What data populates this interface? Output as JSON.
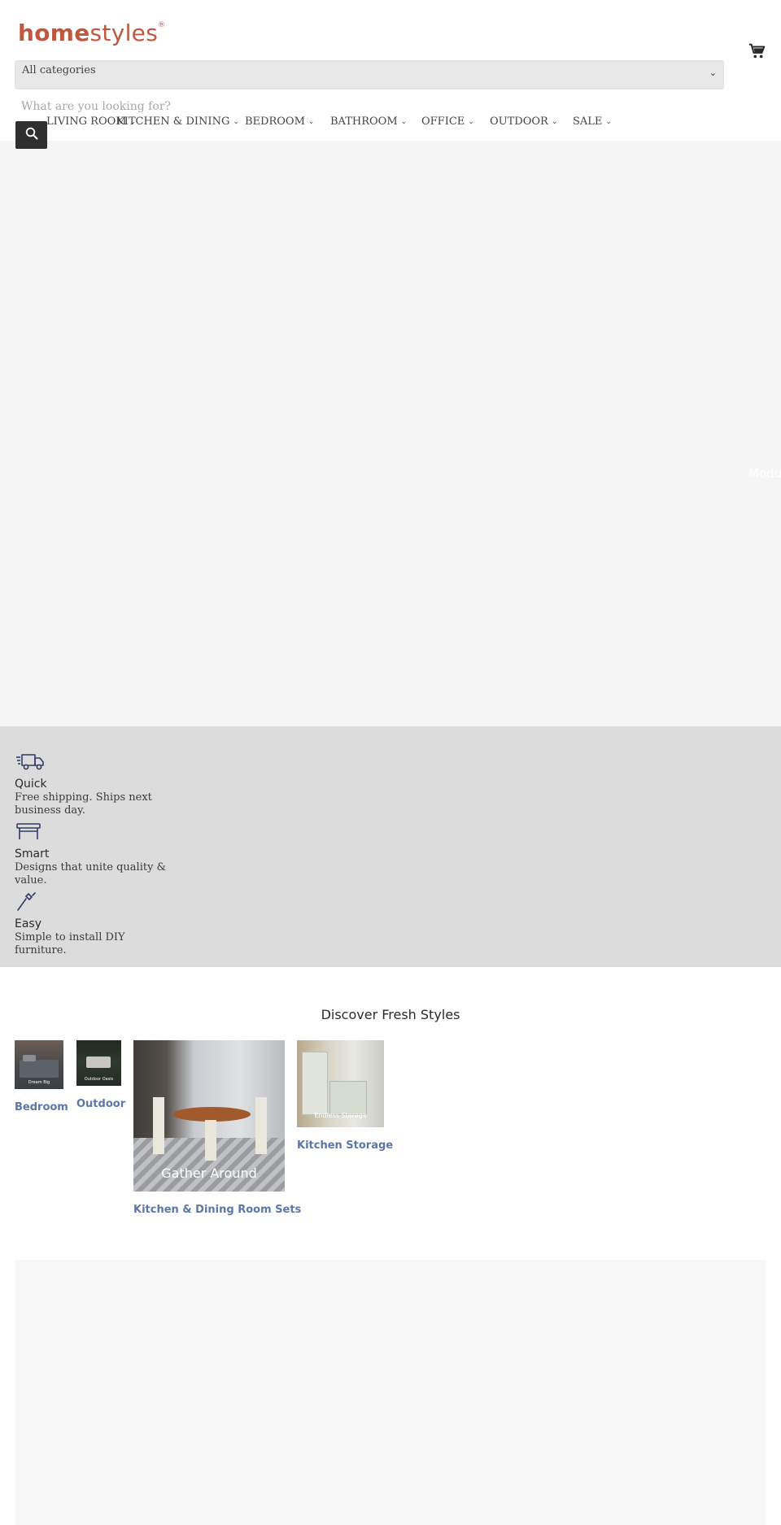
{
  "brand": {
    "logo_bold": "home",
    "logo_light": "styles",
    "logo_mark": "®"
  },
  "header": {
    "category_select": "All categories",
    "search_placeholder": "What are you looking for?",
    "cart_icon": "cart-icon",
    "search_icon": "search-icon"
  },
  "nav": {
    "items": [
      {
        "label": "LIVING ROOM"
      },
      {
        "label": "KITCHEN & DINING"
      },
      {
        "label": "BEDROOM"
      },
      {
        "label": "BATHROOM"
      },
      {
        "label": "OFFICE"
      },
      {
        "label": "OUTDOOR"
      },
      {
        "label": "SALE"
      }
    ]
  },
  "hero": {
    "edge_text": "Modu"
  },
  "features": [
    {
      "icon": "truck-icon",
      "title": "Quick",
      "text": "Free shipping. Ships next business day."
    },
    {
      "icon": "table-icon",
      "title": "Smart",
      "text": "Designs that unite quality & value."
    },
    {
      "icon": "screwdriver-icon",
      "title": "Easy",
      "text": "Simple to install DIY furniture."
    }
  ],
  "discover": {
    "title": "Discover Fresh Styles",
    "tiles": [
      {
        "label": "Bedroom",
        "caption": "Dream Big"
      },
      {
        "label": "Outdoor",
        "caption": "Outdoor Oasis"
      },
      {
        "label": "Kitchen & Dining Room Sets",
        "caption": "Gather Around"
      },
      {
        "label": "Kitchen Storage",
        "caption": "Endless Storage"
      }
    ]
  },
  "colors": {
    "brand": "#c0583f",
    "link": "#5c77a6",
    "features_bg": "#dcdcdc",
    "hero_bg": "#f5f5f5"
  }
}
